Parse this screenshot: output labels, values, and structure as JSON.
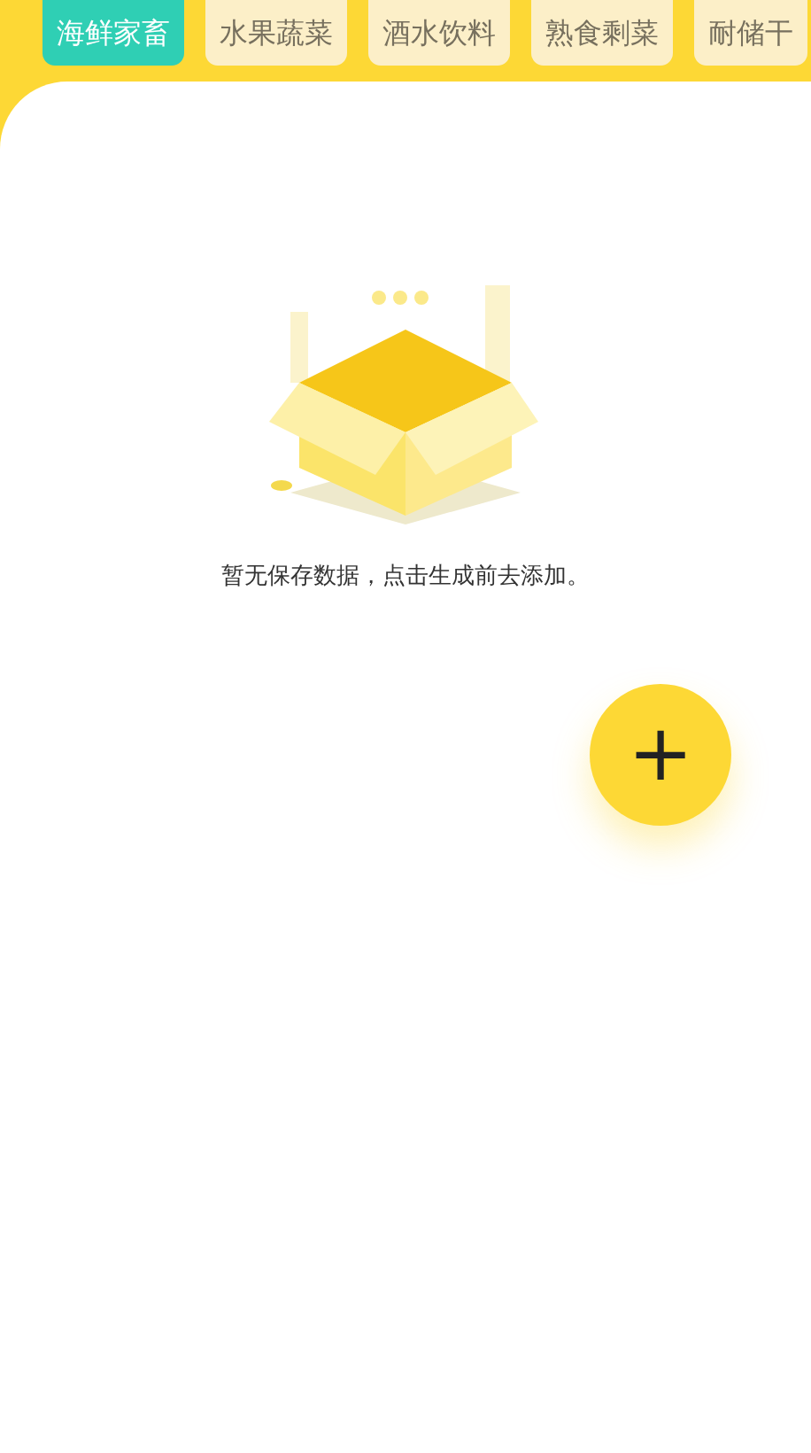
{
  "tabs": [
    {
      "label": "海鲜家畜",
      "selected": true
    },
    {
      "label": "水果蔬菜",
      "selected": false
    },
    {
      "label": "酒水饮料",
      "selected": false
    },
    {
      "label": "熟食剩菜",
      "selected": false
    },
    {
      "label": "耐储干",
      "selected": false
    }
  ],
  "empty_state": {
    "message": "暂无保存数据，点击生成前去添加。"
  },
  "add_button": {
    "label": "+"
  }
}
